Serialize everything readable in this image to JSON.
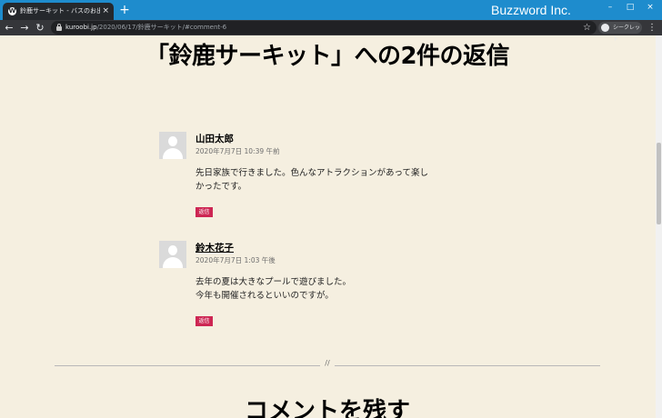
{
  "browser": {
    "tab_title": "鈴鹿サーキット - バスのお出かけブロ",
    "tab_close": "×",
    "new_tab": "+",
    "brand": "Buzzword Inc.",
    "window_controls": [
      "–",
      "□",
      "×"
    ],
    "nav": {
      "back": "←",
      "forward": "→",
      "reload": "↻"
    },
    "url_host": "kuroobi.jp",
    "url_path": "/2020/06/17/鈴鹿サーキット/#comment-6",
    "bookmark": "☆",
    "incognito_label": "シークレット",
    "menu": "⋮"
  },
  "page": {
    "heading": "「鈴鹿サーキット」への2件の返信",
    "comments": [
      {
        "author": "山田太郎",
        "date": "2020年7月7日 10:39 午前",
        "body": [
          "先日家族で行きました。色んなアトラクションがあって楽し",
          "かったです。"
        ],
        "reply": "返信"
      },
      {
        "author": "鈴木花子",
        "date": "2020年7月7日 1:03 午後",
        "body": [
          "去年の夏は大きなプールで遊びました。",
          "今年も開催されるといいのですが。"
        ],
        "reply": "返信"
      }
    ],
    "divider_mark": "//",
    "leave_comment_heading": "コメントを残す"
  }
}
